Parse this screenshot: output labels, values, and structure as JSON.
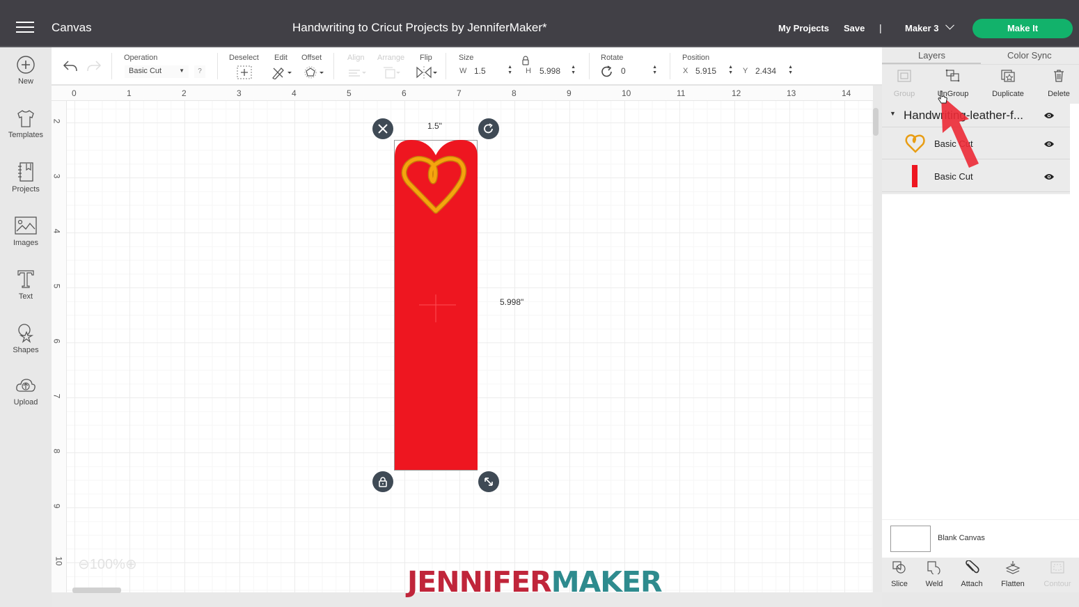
{
  "header": {
    "menu_icon": "hamburger-icon",
    "app_title": "Canvas",
    "document_title": "Handwriting to Cricut Projects by JenniferMaker*",
    "my_projects": "My Projects",
    "save": "Save",
    "separator": "|",
    "machine": "Maker 3",
    "make_it": "Make It",
    "make_it_color": "#12b26b"
  },
  "sidebar": {
    "items": [
      {
        "label": "New",
        "icon": "plus-circle-icon"
      },
      {
        "label": "Templates",
        "icon": "tshirt-icon"
      },
      {
        "label": "Projects",
        "icon": "notebook-icon"
      },
      {
        "label": "Images",
        "icon": "image-icon"
      },
      {
        "label": "Text",
        "icon": "text-icon"
      },
      {
        "label": "Shapes",
        "icon": "shapes-icon"
      },
      {
        "label": "Upload",
        "icon": "cloud-upload-icon"
      }
    ]
  },
  "toolbar": {
    "operation_label": "Operation",
    "operation_value": "Basic Cut",
    "help": "?",
    "deselect": "Deselect",
    "edit": "Edit",
    "offset": "Offset",
    "align": "Align",
    "arrange": "Arrange",
    "flip": "Flip",
    "size_label": "Size",
    "w_label": "W",
    "w_value": "1.5",
    "h_label": "H",
    "h_value": "5.998",
    "rotate_label": "Rotate",
    "rotate_value": "0",
    "position_label": "Position",
    "x_label": "X",
    "x_value": "5.915",
    "y_label": "Y",
    "y_value": "2.434"
  },
  "rulers": {
    "horizontal": [
      "0",
      "1",
      "2",
      "3",
      "4",
      "5",
      "6",
      "7",
      "8",
      "9",
      "10",
      "11",
      "12",
      "13",
      "14"
    ],
    "vertical": [
      "2",
      "3",
      "4",
      "5",
      "6",
      "7",
      "8",
      "9",
      "10"
    ]
  },
  "canvas": {
    "width_label": "1.5\"",
    "height_label": "5.998\"",
    "zoom": "100%",
    "shape_color": "#ee1620",
    "heart_color": "#f5a40e"
  },
  "panel": {
    "tabs": [
      "Layers",
      "Color Sync"
    ],
    "actions": [
      {
        "label": "Group",
        "icon": "group-icon",
        "disabled": true
      },
      {
        "label": "UnGroup",
        "icon": "ungroup-icon",
        "disabled": false
      },
      {
        "label": "Duplicate",
        "icon": "duplicate-icon",
        "disabled": false
      },
      {
        "label": "Delete",
        "icon": "trash-icon",
        "disabled": false
      }
    ],
    "group_name": "Handwriting-leather-f...",
    "layers": [
      {
        "label": "Basic Cut",
        "thumb": "heart"
      },
      {
        "label": "Basic Cut",
        "thumb": "red-bar"
      }
    ],
    "blank_canvas": "Blank Canvas",
    "bottom_actions": [
      {
        "label": "Slice",
        "icon": "slice-icon",
        "disabled": false
      },
      {
        "label": "Weld",
        "icon": "weld-icon",
        "disabled": false
      },
      {
        "label": "Attach",
        "icon": "paperclip-icon",
        "disabled": false
      },
      {
        "label": "Flatten",
        "icon": "flatten-icon",
        "disabled": false
      },
      {
        "label": "Contour",
        "icon": "contour-icon",
        "disabled": true
      }
    ]
  },
  "watermark": {
    "part1": "JENNIFER",
    "part2": "MAKER"
  }
}
